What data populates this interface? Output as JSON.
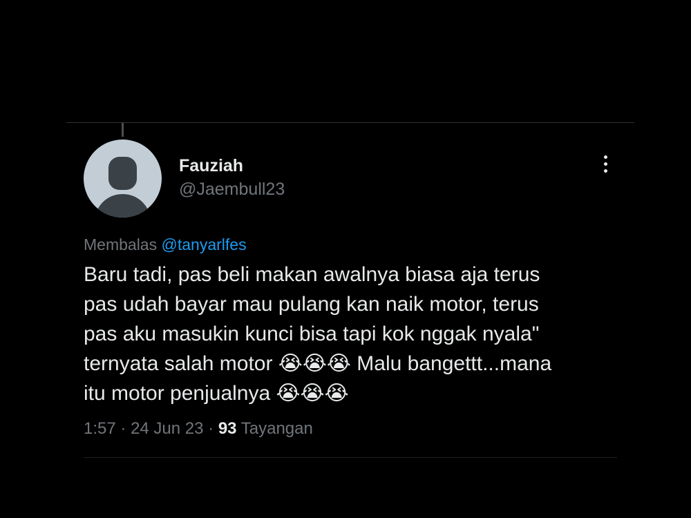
{
  "author": {
    "display_name": "Fauziah",
    "handle": "@Jaembull23"
  },
  "reply": {
    "prefix": "Membalas",
    "mention": "@tanyarlfes"
  },
  "tweet": {
    "text": "Baru tadi, pas beli makan awalnya biasa aja terus\npas udah bayar mau pulang kan naik motor, terus\npas aku masukin kunci bisa tapi kok nggak nyala\"\nternyata salah motor 😭😭😭 Malu bangettt...mana\nitu motor penjualnya 😭😭😭"
  },
  "meta": {
    "time": "1:57",
    "separator": "·",
    "date": "24 Jun 23",
    "views_count": "93",
    "views_label": "Tayangan"
  },
  "icons": {
    "more": "more-vertical-icon",
    "avatar": "default-profile-icon"
  },
  "colors": {
    "background": "#000000",
    "text_primary": "#e7e9ea",
    "text_secondary": "#71767b",
    "accent": "#1d9bf0"
  }
}
